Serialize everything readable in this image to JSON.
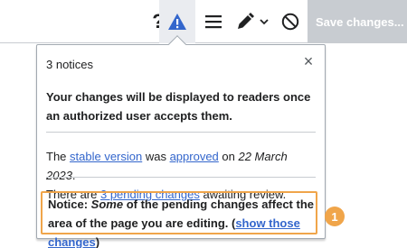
{
  "toolbar": {
    "help_glyph": "?",
    "notices_icon": "alert-icon",
    "menu_icon": "hamburger-menu-icon",
    "edit_icon": "pencil-icon",
    "cancel_icon": "cancel-icon",
    "save_label": "Save changes..."
  },
  "popup": {
    "count": "3 notices",
    "close_glyph": "×",
    "notice1": "Your changes will be displayed to readers once an authorized user accepts them.",
    "notice2": {
      "t1": "The ",
      "link_stable": "stable version",
      "t2": " was ",
      "link_approved": "approved",
      "t3": " on ",
      "date": "22 March 2023",
      "t4": ".",
      "t5": "There are ",
      "link_pending": "3 pending changes",
      "t6": " awaiting review."
    },
    "notice3": {
      "prefix": "Notice: ",
      "some": "Some",
      "t1": " of the pending changes affect the area of the page you are editing. (",
      "link_show": "show those changes",
      "t2": ")"
    }
  },
  "callout_number": "1",
  "colors": {
    "accent_blue": "#3366cc",
    "highlight_orange": "#f0a54a",
    "save_disabled": "#c8ccd1"
  }
}
